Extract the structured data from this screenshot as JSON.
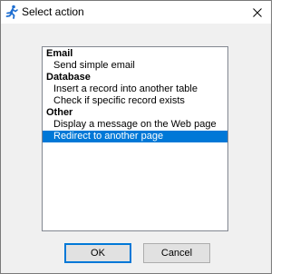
{
  "window": {
    "title": "Select action",
    "icon": "running-figure-icon",
    "close_icon": "close-icon"
  },
  "list": {
    "rows": [
      {
        "type": "group",
        "label": "Email"
      },
      {
        "type": "item",
        "label": "Send simple email"
      },
      {
        "type": "group",
        "label": "Database"
      },
      {
        "type": "item",
        "label": "Insert a record into another table"
      },
      {
        "type": "item",
        "label": "Check if specific record exists"
      },
      {
        "type": "group",
        "label": "Other"
      },
      {
        "type": "item",
        "label": "Display a message on the Web page"
      },
      {
        "type": "item",
        "label": "Redirect to another page",
        "selected": true
      }
    ]
  },
  "buttons": {
    "ok_label": "OK",
    "cancel_label": "Cancel"
  },
  "colors": {
    "selection": "#0078d7",
    "default_button_border": "#0078d7"
  }
}
